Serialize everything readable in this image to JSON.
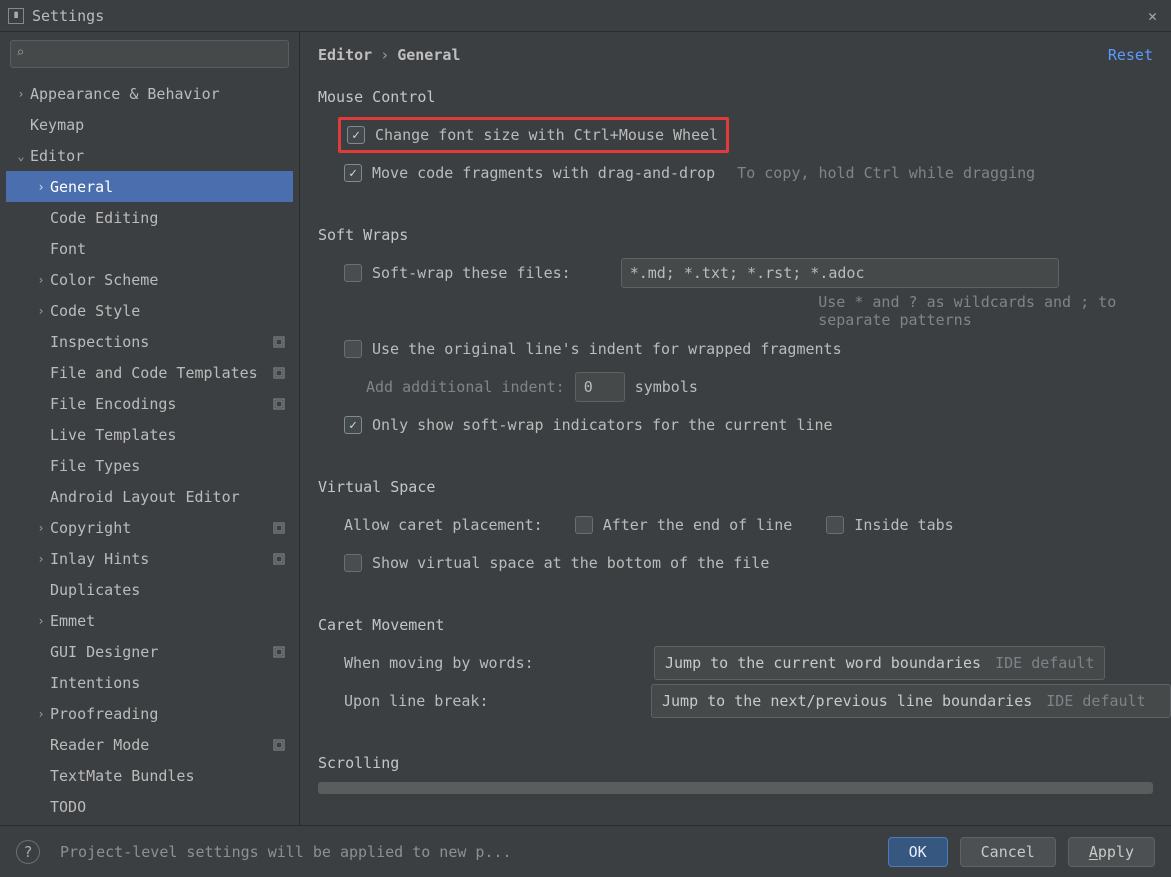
{
  "window": {
    "title": "Settings"
  },
  "sidebar": {
    "search_placeholder": "",
    "items": [
      {
        "label": "Appearance & Behavior",
        "arrow": ">",
        "indent": 1
      },
      {
        "label": "Keymap",
        "arrow": "",
        "indent": 1
      },
      {
        "label": "Editor",
        "arrow": "v",
        "indent": 1
      },
      {
        "label": "General",
        "arrow": ">",
        "indent": 2,
        "selected": true
      },
      {
        "label": "Code Editing",
        "arrow": "",
        "indent": 2
      },
      {
        "label": "Font",
        "arrow": "",
        "indent": 2
      },
      {
        "label": "Color Scheme",
        "arrow": ">",
        "indent": 2
      },
      {
        "label": "Code Style",
        "arrow": ">",
        "indent": 2
      },
      {
        "label": "Inspections",
        "arrow": "",
        "indent": 2,
        "mark": true
      },
      {
        "label": "File and Code Templates",
        "arrow": "",
        "indent": 2,
        "mark": true
      },
      {
        "label": "File Encodings",
        "arrow": "",
        "indent": 2,
        "mark": true
      },
      {
        "label": "Live Templates",
        "arrow": "",
        "indent": 2
      },
      {
        "label": "File Types",
        "arrow": "",
        "indent": 2
      },
      {
        "label": "Android Layout Editor",
        "arrow": "",
        "indent": 2
      },
      {
        "label": "Copyright",
        "arrow": ">",
        "indent": 2,
        "mark": true
      },
      {
        "label": "Inlay Hints",
        "arrow": ">",
        "indent": 2,
        "mark": true
      },
      {
        "label": "Duplicates",
        "arrow": "",
        "indent": 2
      },
      {
        "label": "Emmet",
        "arrow": ">",
        "indent": 2
      },
      {
        "label": "GUI Designer",
        "arrow": "",
        "indent": 2,
        "mark": true
      },
      {
        "label": "Intentions",
        "arrow": "",
        "indent": 2
      },
      {
        "label": "Proofreading",
        "arrow": ">",
        "indent": 2
      },
      {
        "label": "Reader Mode",
        "arrow": "",
        "indent": 2,
        "mark": true
      },
      {
        "label": "TextMate Bundles",
        "arrow": "",
        "indent": 2
      },
      {
        "label": "TODO",
        "arrow": "",
        "indent": 2
      }
    ]
  },
  "breadcrumb": {
    "a": "Editor",
    "sep": "›",
    "b": "General"
  },
  "reset_label": "Reset",
  "sections": {
    "mouse": {
      "title": "Mouse Control",
      "opt_font": "Change font size with Ctrl+Mouse Wheel",
      "opt_drag": "Move code fragments with drag-and-drop",
      "drag_hint": "To copy, hold Ctrl while dragging"
    },
    "soft": {
      "title": "Soft Wraps",
      "opt_files": "Soft-wrap these files:",
      "files_value": "*.md; *.txt; *.rst; *.adoc",
      "files_hint": "Use * and ? as wildcards and ; to separate patterns",
      "opt_indent": "Use the original line's indent for wrapped fragments",
      "add_indent_lbl": "Add additional indent:",
      "add_indent_val": "0",
      "add_indent_unit": "symbols",
      "opt_only": "Only show soft-wrap indicators for the current line"
    },
    "vspace": {
      "title": "Virtual Space",
      "caret_lbl": "Allow caret placement:",
      "opt_after": "After the end of line",
      "opt_inside": "Inside tabs",
      "opt_bottom": "Show virtual space at the bottom of the file"
    },
    "caret": {
      "title": "Caret Movement",
      "words_lbl": "When moving by words:",
      "words_val": "Jump to the current word boundaries",
      "words_hint": "IDE default",
      "break_lbl": "Upon line break:",
      "break_val": "Jump to the next/previous line boundaries",
      "break_hint": "IDE default"
    },
    "scroll": {
      "title": "Scrolling"
    }
  },
  "footer": {
    "note": "Project-level settings will be applied to new p...",
    "ok": "OK",
    "cancel": "Cancel",
    "apply": "Apply"
  }
}
